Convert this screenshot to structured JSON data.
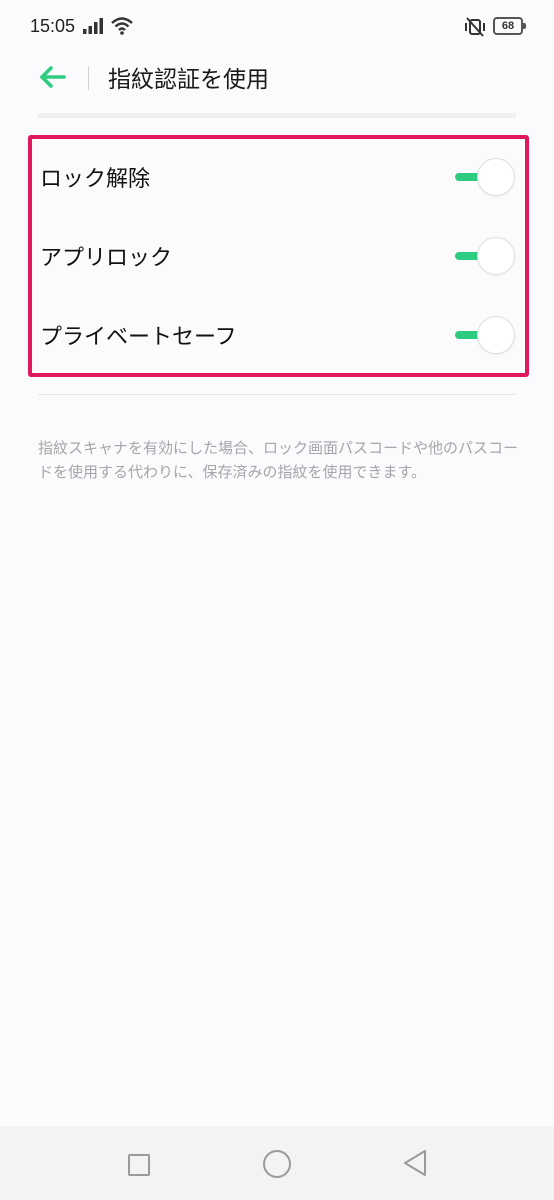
{
  "status_bar": {
    "time": "15:05",
    "battery": "68",
    "icons": [
      "signal-icon",
      "wifi-icon",
      "vibrate-off-icon",
      "battery-icon"
    ]
  },
  "header": {
    "title": "指紋認証を使用",
    "back_icon": "arrow-left-icon"
  },
  "settings": {
    "items": [
      {
        "label": "ロック解除",
        "enabled": true
      },
      {
        "label": "アプリロック",
        "enabled": true
      },
      {
        "label": "プライベートセーフ",
        "enabled": true
      }
    ]
  },
  "description": "指紋スキャナを有効にした場合、ロック画面パスコードや他のパスコードを使用する代わりに、保存済みの指紋を使用できます。",
  "colors": {
    "accent": "#2ecc80",
    "highlight_border": "#e0185c",
    "description_text": "#a6a6aa"
  },
  "nav_bar": {
    "icons": [
      "recent-apps-icon",
      "home-icon",
      "back-icon"
    ]
  }
}
